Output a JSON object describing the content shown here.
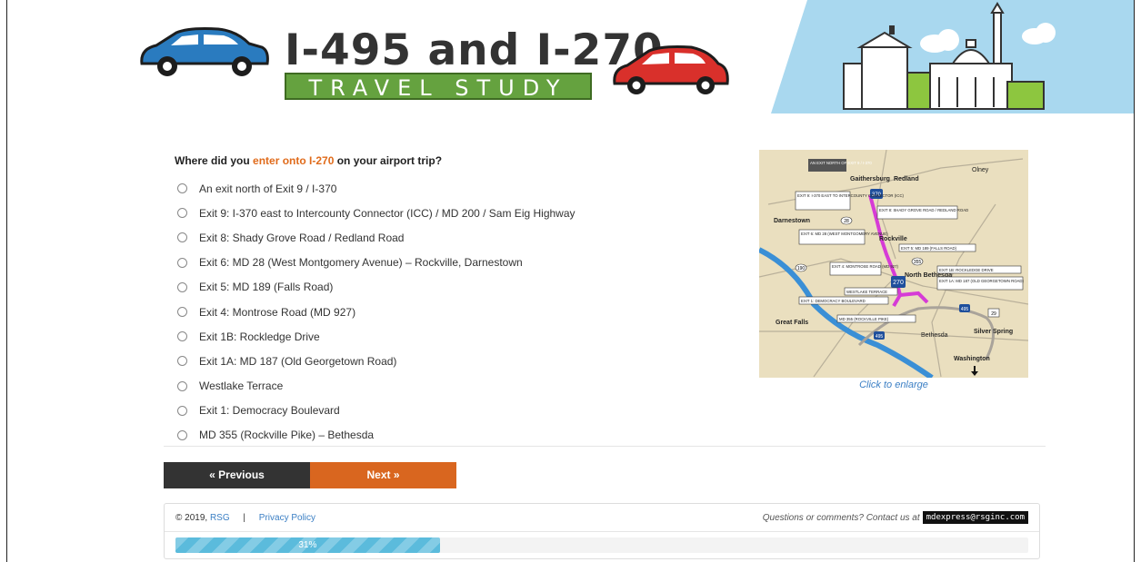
{
  "header": {
    "title": "I-495 and I-270",
    "subtitle": "TRAVEL STUDY"
  },
  "colors": {
    "accent_orange": "#d9661f",
    "accent_green": "#65a23f",
    "progress_blue": "#5bbbdc",
    "link_blue": "#3b7fc4"
  },
  "question": {
    "prefix": "Where did you ",
    "highlight": "enter onto I-270",
    "suffix": " on your airport trip?"
  },
  "options": [
    {
      "label": "An exit north of Exit 9 / I-370"
    },
    {
      "label": "Exit 9: I-370 east to Intercounty Connector (ICC) / MD 200 / Sam Eig Highway"
    },
    {
      "label": "Exit 8: Shady Grove Road / Redland Road"
    },
    {
      "label": "Exit 6: MD 28 (West Montgomery Avenue) – Rockville, Darnestown"
    },
    {
      "label": "Exit 5: MD 189 (Falls Road)"
    },
    {
      "label": "Exit 4: Montrose Road (MD 927)"
    },
    {
      "label": "Exit 1B: Rockledge Drive"
    },
    {
      "label": "Exit 1A: MD 187 (Old Georgetown Road)"
    },
    {
      "label": "Westlake Terrace"
    },
    {
      "label": "Exit 1: Democracy Boulevard"
    },
    {
      "label": "MD 355 (Rockville Pike) – Bethesda"
    }
  ],
  "map": {
    "enlarge_label": "Click to enlarge",
    "towns": [
      "Gaithersburg",
      "Redland",
      "Olney",
      "Darnestown",
      "Rockville",
      "North Bethesda",
      "Great Falls",
      "Bethesda",
      "Silver Spring",
      "Washington"
    ],
    "callouts": [
      "AN EXIT NORTH OF EXIT 9 / I-370",
      "EXIT 9: I-370 EAST TO INTERCOUNTY CONNECTOR (ICC)",
      "EXIT 8: SHADY GROVE ROAD / REDLAND ROAD",
      "EXIT 6: MD 28 (WEST MONTGOMERY AVENUE)",
      "EXIT 5: MD 189 (FALLS ROAD)",
      "EXIT 4: MONTROSE ROAD (MD 927)",
      "EXIT 1B: ROCKLEDGE DRIVE",
      "EXIT 1A: MD 187 (OLD GEORGETOWN ROAD)",
      "WESTLAKE TERRACE",
      "EXIT 1: DEMOCRACY BOULEVARD",
      "MD 355 (ROCKVILLE PIKE)"
    ],
    "shields": [
      "270",
      "28",
      "355",
      "190",
      "495",
      "29",
      "370",
      "495"
    ]
  },
  "nav": {
    "previous_label": "« Previous",
    "next_label": "Next »"
  },
  "footer": {
    "copyright": "© 2019,",
    "company_link": "RSG",
    "separator": "|",
    "privacy_link": "Privacy Policy",
    "contact_text": "Questions or comments? Contact us at",
    "email": "mdexpress@rsginc.com",
    "progress_label": "31%",
    "progress_value": 0.31
  }
}
